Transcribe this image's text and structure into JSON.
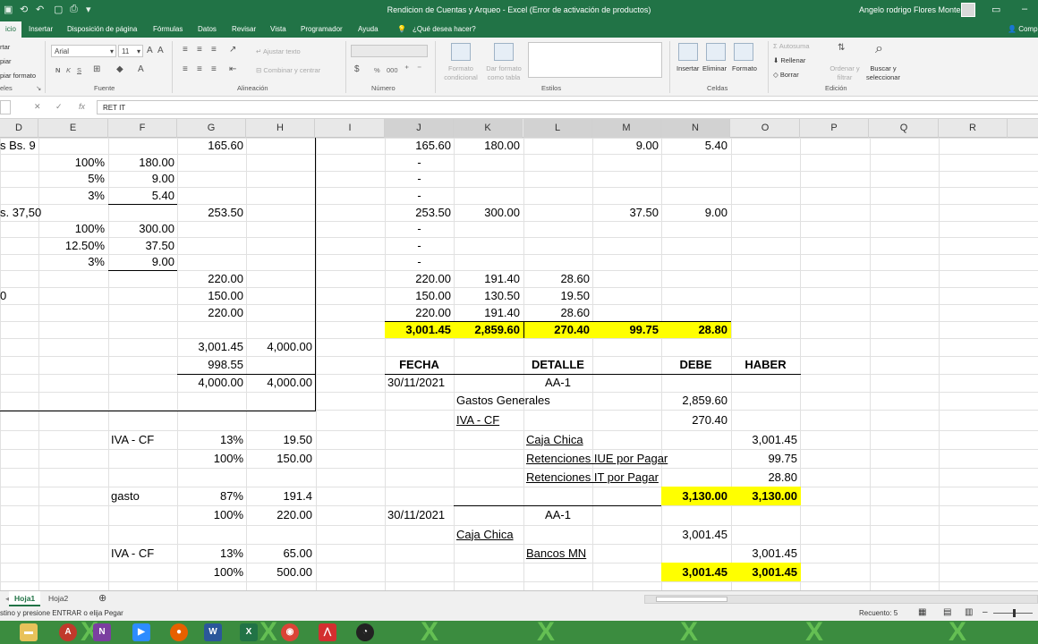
{
  "window": {
    "title": "Rendicion de Cuentas y Arqueo  -  Excel (Error de activación de productos)",
    "user": "Angelo rodrigo Flores Montes"
  },
  "tabs": [
    "icio",
    "Insertar",
    "Disposición de página",
    "Fórmulas",
    "Datos",
    "Revisar",
    "Vista",
    "Programador",
    "Ayuda",
    "¿Qué desea hacer?",
    "Comp"
  ],
  "ribbon": {
    "clipboard": {
      "cut": "rtar",
      "copy": "piar",
      "format_painter": "piar formato",
      "label": "eles"
    },
    "font": {
      "name": "Arial",
      "size": "11",
      "bold": "N",
      "italic": "K",
      "underline": "S",
      "label": "Fuente"
    },
    "alignment": {
      "wrap": "Ajustar texto",
      "merge": "Combinar y centrar",
      "label": "Alineación"
    },
    "number": {
      "percent": "%",
      "thousands": "000",
      "label": "Número"
    },
    "styles": {
      "conditional": "Formato condicional",
      "table": "Dar formato como tabla",
      "label": "Estilos"
    },
    "cells": {
      "insert": "Insertar",
      "delete": "Eliminar",
      "format": "Formato",
      "label": "Celdas"
    },
    "editing": {
      "autosum": "Autosuma",
      "fill": "Rellenar",
      "clear": "Borrar",
      "sort": "Ordenar y filtrar",
      "find": "Buscar y seleccionar",
      "label": "Edición"
    }
  },
  "formula_bar": {
    "fx": "fx",
    "content": "RET IT"
  },
  "columns": [
    "D",
    "E",
    "F",
    "G",
    "H",
    "I",
    "J",
    "K",
    "L",
    "M",
    "N",
    "O",
    "P",
    "Q",
    "R"
  ],
  "cells": {
    "r1": {
      "D": "s Bs. 9",
      "G": "165.60",
      "J": "165.60",
      "K": "180.00",
      "M": "9.00",
      "N": "5.40"
    },
    "r2": {
      "E": "100%",
      "F": "180.00",
      "J": "-"
    },
    "r3": {
      "E": "5%",
      "F": "9.00",
      "J": "-"
    },
    "r4": {
      "E": "3%",
      "F": "5.40",
      "J": "-"
    },
    "r5": {
      "D": "s. 37,50",
      "G": "253.50",
      "J": "253.50",
      "K": "300.00",
      "M": "37.50",
      "N": "9.00"
    },
    "r6": {
      "E": "100%",
      "F": "300.00",
      "J": "-"
    },
    "r7": {
      "E": "12.50%",
      "F": "37.50",
      "J": "-"
    },
    "r8": {
      "E": "3%",
      "F": "9.00",
      "J": "-"
    },
    "r9": {
      "G": "220.00",
      "J": "220.00",
      "K": "191.40",
      "L": "28.60"
    },
    "r10": {
      "D": "0",
      "G": "150.00",
      "J": "150.00",
      "K": "130.50",
      "L": "19.50"
    },
    "r11": {
      "G": "220.00",
      "J": "220.00",
      "K": "191.40",
      "L": "28.60"
    },
    "r12": {
      "J": "3,001.45",
      "K": "2,859.60",
      "L": "270.40",
      "M": "99.75",
      "N": "28.80"
    },
    "r13": {
      "G": "3,001.45",
      "H": "4,000.00"
    },
    "r14": {
      "G": "998.55",
      "J": "FECHA",
      "L": "DETALLE",
      "N": "DEBE",
      "O": "HABER"
    },
    "r15": {
      "G": "4,000.00",
      "H": "4,000.00",
      "J": "30/11/2021",
      "L": "AA-1"
    },
    "r16": {
      "K": "Gastos Generales",
      "N": "2,859.60"
    },
    "r17": {
      "K": "IVA - CF",
      "N": "270.40"
    },
    "r18": {
      "F": "IVA - CF",
      "G": "13%",
      "H": "19.50",
      "L": "Caja Chica",
      "O": "3,001.45"
    },
    "r19": {
      "G": "100%",
      "H": "150.00",
      "L": "Retenciones IUE por Pagar",
      "O": "99.75"
    },
    "r20": {
      "L": "Retenciones IT por Pagar",
      "O": "28.80"
    },
    "r21": {
      "F": "gasto",
      "G": "87%",
      "H": "191.4",
      "N": "3,130.00",
      "O": "3,130.00"
    },
    "r22": {
      "G": "100%",
      "H": "220.00",
      "J": "30/11/2021",
      "L": "AA-1"
    },
    "r23": {
      "K": "Caja Chica",
      "N": "3,001.45"
    },
    "r24": {
      "F": "IVA - CF",
      "G": "13%",
      "H": "65.00",
      "L": "Bancos MN",
      "O": "3,001.45"
    },
    "r25": {
      "G": "100%",
      "H": "500.00",
      "N": "3,001.45",
      "O": "3,001.45"
    }
  },
  "sheets": [
    "Hoja1",
    "Hoja2"
  ],
  "status": {
    "message": "stino y presione ENTRAR o elija Pegar",
    "count": "Recuento: 5"
  },
  "colors": {
    "excel_green": "#217346",
    "highlight": "#ffff00"
  }
}
